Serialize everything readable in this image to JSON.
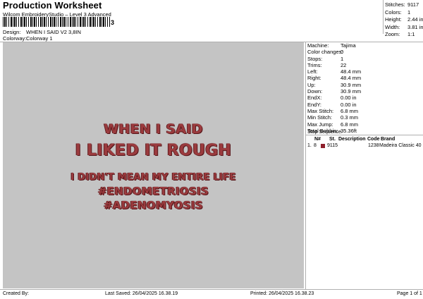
{
  "header": {
    "title": "Production Worksheet",
    "subtitle": "Wilcom EmbroideryStudio – Level 3 Advanced",
    "barcode_suffix": "3"
  },
  "meta": [
    {
      "label": "Design:",
      "value": "WHEN I SAID V2 3,8IN"
    },
    {
      "label": "Colorway:",
      "value": "Colorway 1"
    }
  ],
  "stats": [
    {
      "label": "Stitches:",
      "value": "9117"
    },
    {
      "label": "Colors:",
      "value": "1"
    },
    {
      "label": "Height:",
      "value": "2.44 in"
    },
    {
      "label": "Width:",
      "value": "3.81 in"
    },
    {
      "label": "Zoom:",
      "value": "1:1"
    }
  ],
  "design_text": [
    "WHEN I SAID",
    "I LIKED IT ROUGH",
    "I DIDN'T MEAN MY ENTIRE LIFE",
    "#ENDOMETRIOSIS",
    "#ADENOMYOSIS"
  ],
  "thread_color": "#9b3b3e",
  "info": [
    {
      "label": "Machine:",
      "value": "Tajima"
    },
    {
      "label": "Color changes:",
      "value": "0"
    },
    {
      "label": "Stops:",
      "value": "1"
    },
    {
      "label": "Trims:",
      "value": "22"
    },
    {
      "label": "Left:",
      "value": "48.4 mm"
    },
    {
      "label": "Right:",
      "value": "48.4 mm"
    },
    {
      "label": "Up:",
      "value": "30.9 mm"
    },
    {
      "label": "Down:",
      "value": "30.9 mm"
    },
    {
      "label": "EndX:",
      "value": "0.00 in"
    },
    {
      "label": "EndY:",
      "value": "0.00 in"
    },
    {
      "label": "Max Stitch:",
      "value": "6.8 mm"
    },
    {
      "label": "Min Stitch:",
      "value": "0.3 mm"
    },
    {
      "label": "Max Jump:",
      "value": "6.8 mm"
    },
    {
      "label": "Total Bobbin:",
      "value": "35.36ft"
    }
  ],
  "stop_sequence": {
    "title": "Stop Sequence:",
    "headers": {
      "num": "N#",
      "st": "St.",
      "desc": "Description",
      "code": "Code",
      "brand": "Brand"
    },
    "rows": [
      {
        "idx": "1.",
        "num": "8",
        "st": "9115",
        "desc": "",
        "code": "1238",
        "brand": "Madeira Classic 40",
        "color": "#8e1f2b"
      }
    ]
  },
  "footer": {
    "created_by": "Created By:",
    "last_saved": "Last Saved: 26/04/2025 16.38.19",
    "printed": "Printed: 26/04/2025 16.38.23",
    "page": "Page 1 of 1"
  }
}
